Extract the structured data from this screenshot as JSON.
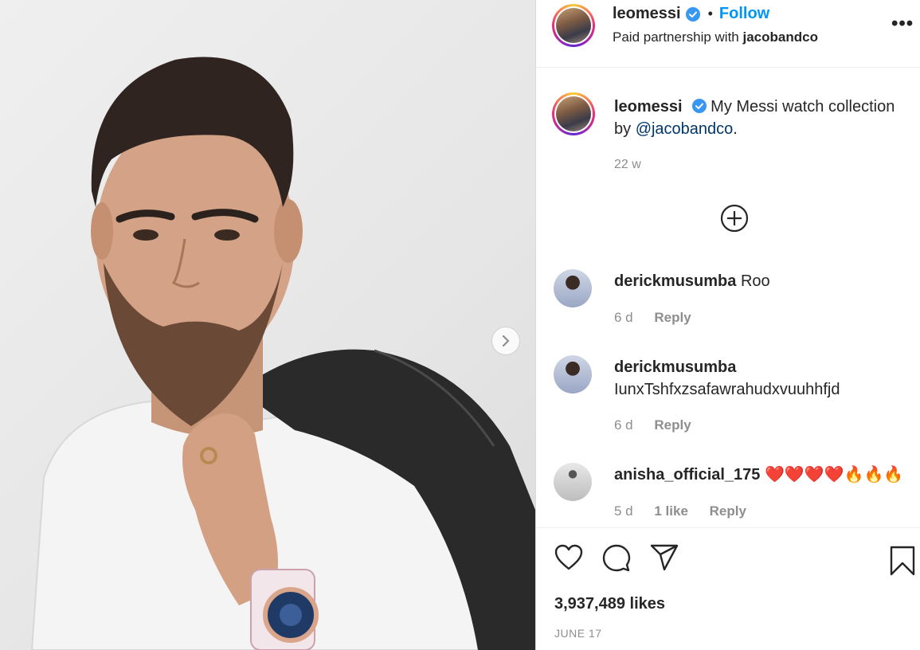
{
  "post": {
    "username": "leomessi",
    "separator": "•",
    "follow_label": "Follow",
    "paid_partnership_prefix": "Paid partnership with",
    "partner": "jacobandco",
    "more_label": "•••",
    "caption_text": "My Messi watch collection by",
    "caption_mention": "@jacobandco",
    "caption_end": ".",
    "time_ago": "22 w",
    "likes": "3,937,489 likes",
    "date": "JUNE 17"
  },
  "comments": [
    {
      "username": "derickmusumba",
      "text": "Roo",
      "age": "6 d",
      "reply": "Reply"
    },
    {
      "username": "derickmusumba",
      "text": "IunxTshfxzsafawrahudxvuuhhfjd",
      "age": "6 d",
      "reply": "Reply"
    },
    {
      "username": "anisha_official_175",
      "text": "❤️❤️❤️❤️🔥🔥🔥",
      "age": "5 d",
      "likes": "1 like",
      "reply": "Reply"
    }
  ],
  "icons": {
    "verified": "verified-badge-icon",
    "next": "chevron-right-icon",
    "load_more": "plus-circle-icon",
    "like": "heart-icon",
    "comment": "comment-icon",
    "share": "paper-plane-icon",
    "save": "bookmark-icon"
  },
  "colors": {
    "accent": "#0095f6",
    "mention": "#00376b",
    "verified": "#3897f0",
    "heart": "#e0245e",
    "fire": "#ff8c1a"
  }
}
